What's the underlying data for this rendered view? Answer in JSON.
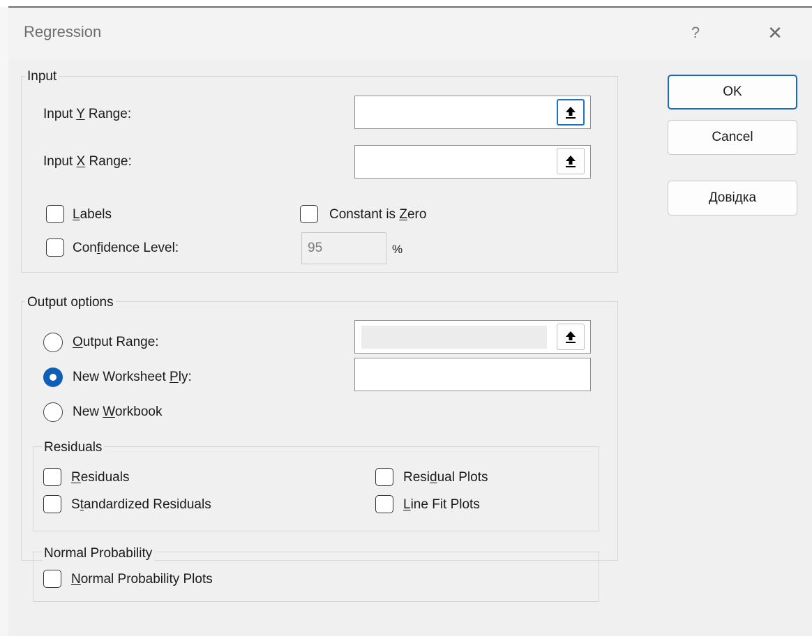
{
  "dialog": {
    "title": "Regression",
    "help_glyph": "?",
    "close_glyph": "✕"
  },
  "input": {
    "group_label": "Input",
    "y_range": {
      "label_pre": "Input ",
      "label_key": "Y",
      "label_post": " Range:",
      "value": ""
    },
    "x_range": {
      "label_pre": "Input ",
      "label_key": "X",
      "label_post": " Range:",
      "value": ""
    },
    "labels": {
      "key": "L",
      "rest": "abels",
      "checked": false
    },
    "constant_zero": {
      "pre": "Constant is ",
      "key": "Z",
      "post": "ero",
      "checked": false
    },
    "confidence": {
      "pre": "Con",
      "key": "f",
      "post": "idence Level:",
      "checked": false,
      "value": "95",
      "unit": "%"
    }
  },
  "output": {
    "group_label": "Output options",
    "output_range": {
      "key": "O",
      "rest": "utput Range:",
      "selected": false,
      "value": ""
    },
    "new_worksheet": {
      "pre": "New Worksheet ",
      "key": "P",
      "post": "ly:",
      "selected": true,
      "value": ""
    },
    "new_workbook": {
      "pre": "New ",
      "key": "W",
      "post": "orkbook",
      "selected": false
    },
    "residuals_group": {
      "label": "Residuals",
      "residuals": {
        "key": "R",
        "rest": "esiduals",
        "checked": false
      },
      "standardized": {
        "pre": "S",
        "key": "t",
        "post": "andardized Residuals",
        "checked": false
      },
      "residual_plots": {
        "pre": "Resi",
        "key": "d",
        "post": "ual Plots",
        "checked": false
      },
      "line_fit": {
        "key": "L",
        "rest": "ine Fit Plots",
        "checked": false
      }
    },
    "normal_group": {
      "label": "Normal Probability",
      "plots": {
        "key": "N",
        "rest": "ormal Probability Plots",
        "checked": false
      }
    }
  },
  "buttons": {
    "ok": "OK",
    "cancel": "Cancel",
    "help_key": "Д",
    "help_rest": "овідка"
  },
  "icons": {
    "range_selector": "collapse-up-arrow-icon"
  },
  "colors": {
    "accent": "#0f5fb7",
    "focus_border": "#1669c2"
  }
}
